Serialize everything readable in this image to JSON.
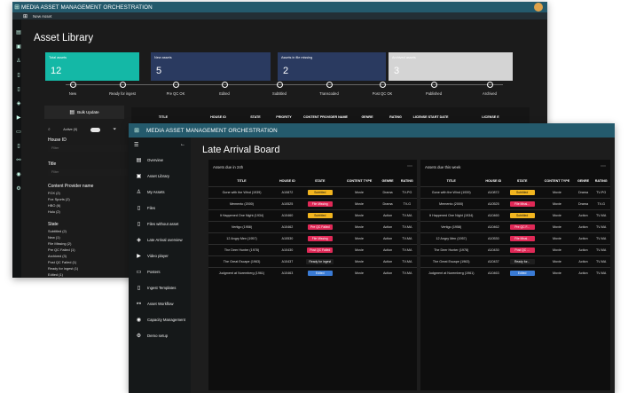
{
  "app": {
    "title": "MEDIA ASSET MANAGEMENT ORCHESTRATION",
    "new_asset_label": "New Asset",
    "page_title": "Asset Library",
    "accent": "#16b6a8"
  },
  "cards": [
    {
      "label": "Total assets",
      "value": "12",
      "color": "#12b8a6"
    },
    {
      "label": "New assets",
      "value": "5",
      "color": "#2b3f66"
    },
    {
      "label": "Assets in file missing",
      "value": "2",
      "color": "#2b3f66"
    },
    {
      "label": "Archived assets",
      "value": "3",
      "color": "#cfcfcf"
    }
  ],
  "workflow": [
    "New",
    "Ready for ingest",
    "Pre QC OK",
    "Edited",
    "Subtitled",
    "Transcoded",
    "Post QC OK",
    "Published",
    "Archived"
  ],
  "library": {
    "bulk_update": "Bulk Update",
    "active_label": "Active (0)",
    "columns": [
      "TITLE",
      "HOUSE ID",
      "STATE",
      "PRIORITY",
      "CONTENT PROVIDER NAME",
      "GENRE",
      "RATING",
      "LICENSE START DATE",
      "LICENSE E"
    ]
  },
  "filters": [
    {
      "title": "House ID",
      "placeholder": "Filter"
    },
    {
      "title": "Title",
      "placeholder": "Filter"
    },
    {
      "title": "Content Provider name",
      "options": [
        "FOX (2)",
        "Fox Sports (2)",
        "HBO (6)",
        "Hulu (2)"
      ]
    },
    {
      "title": "State",
      "options": [
        "Subtitled (2)",
        "New (1)",
        "File Missing (2)",
        "Pre QC Failed (1)",
        "Archived (3)",
        "Post QC Failed (1)",
        "Ready for ingest (1)",
        "Edited (1)"
      ]
    }
  ],
  "nav": [
    {
      "label": "Overview",
      "icon": "overview"
    },
    {
      "label": "Asset Library",
      "icon": "library"
    },
    {
      "label": "My Assets",
      "icon": "user"
    },
    {
      "label": "Files",
      "icon": "file"
    },
    {
      "label": "Files without asset",
      "icon": "file-missing"
    },
    {
      "label": "Late Arrival overview",
      "icon": "late"
    },
    {
      "label": "Video player",
      "icon": "play"
    },
    {
      "label": "Posters",
      "icon": "image"
    },
    {
      "label": "Ingest Templates",
      "icon": "template"
    },
    {
      "label": "Asset Workflow",
      "icon": "workflow"
    },
    {
      "label": "Capacity Management",
      "icon": "gauge"
    },
    {
      "label": "Demo setup",
      "icon": "settings"
    }
  ],
  "late": {
    "title": "Late Arrival Board",
    "panel1_title": "Assets due in 24h",
    "panel2_title": "Assets due this week",
    "columns": [
      "TITLE",
      "HOUSE ID",
      "STATE",
      "CONTENT TYPE",
      "GENRE",
      "RATING"
    ],
    "rows1": [
      [
        "Gone with the Wind (1939)",
        "A10872",
        "Subtitled",
        "Movie",
        "Drama",
        "TV-PG"
      ],
      [
        "Memento (2000)",
        "A10525",
        "File Missing",
        "Movie",
        "Drama",
        "TV-G"
      ],
      [
        "It Happened One Night (1934)",
        "A10460",
        "Subtitled",
        "Movie",
        "Action",
        "TV-MA"
      ],
      [
        "Vertigo (1958)",
        "A10462",
        "Pre QC Failed",
        "Movie",
        "Action",
        "TV-MA"
      ],
      [
        "12 Angry Men (1957)",
        "A10530",
        "File Missing",
        "Movie",
        "Action",
        "TV-MA"
      ],
      [
        "The Deer Hunter (1978)",
        "A10430",
        "Post QC Failed",
        "Movie",
        "Action",
        "TV-MA"
      ],
      [
        "The Great Escape (1963)",
        "A10437",
        "Ready for ingest",
        "Movie",
        "Action",
        "TV-MA"
      ],
      [
        "Judgment at Nuremberg (1961)",
        "A10463",
        "Edited",
        "Movie",
        "Action",
        "TV-MA"
      ]
    ],
    "rows2": [
      [
        "Gone with the Wind (1939)",
        "A10872",
        "Subtitled",
        "Movie",
        "Drama",
        "TV-PG"
      ],
      [
        "Memento (2000)",
        "A10525",
        "File Missi...",
        "Movie",
        "Drama",
        "TV-G"
      ],
      [
        "It Happened One Night (1934)",
        "A10460",
        "Subtitled",
        "Movie",
        "Action",
        "TV-MA"
      ],
      [
        "Vertigo (1958)",
        "A10462",
        "Pre QC F...",
        "Movie",
        "Action",
        "TV-MA"
      ],
      [
        "12 Angry Men (1957)",
        "A10530",
        "File Missi...",
        "Movie",
        "Action",
        "TV-MA"
      ],
      [
        "The Deer Hunter (1978)",
        "A10430",
        "Post QC ...",
        "Movie",
        "Action",
        "TV-MA"
      ],
      [
        "The Great Escape (1963)",
        "A10437",
        "Ready for...",
        "Movie",
        "Action",
        "TV-MA"
      ],
      [
        "Judgment at Nuremberg (1961)",
        "A10463",
        "Edited",
        "Movie",
        "Action",
        "TV-MA"
      ]
    ],
    "state_colors": {
      "Subtitled": "#f2b51f",
      "File Missing": "#e02957",
      "Pre QC Failed": "#e02957",
      "Post QC Failed": "#e02957",
      "Ready for ingest": "#1e1e1e",
      "Edited": "#3a7bd5"
    }
  }
}
